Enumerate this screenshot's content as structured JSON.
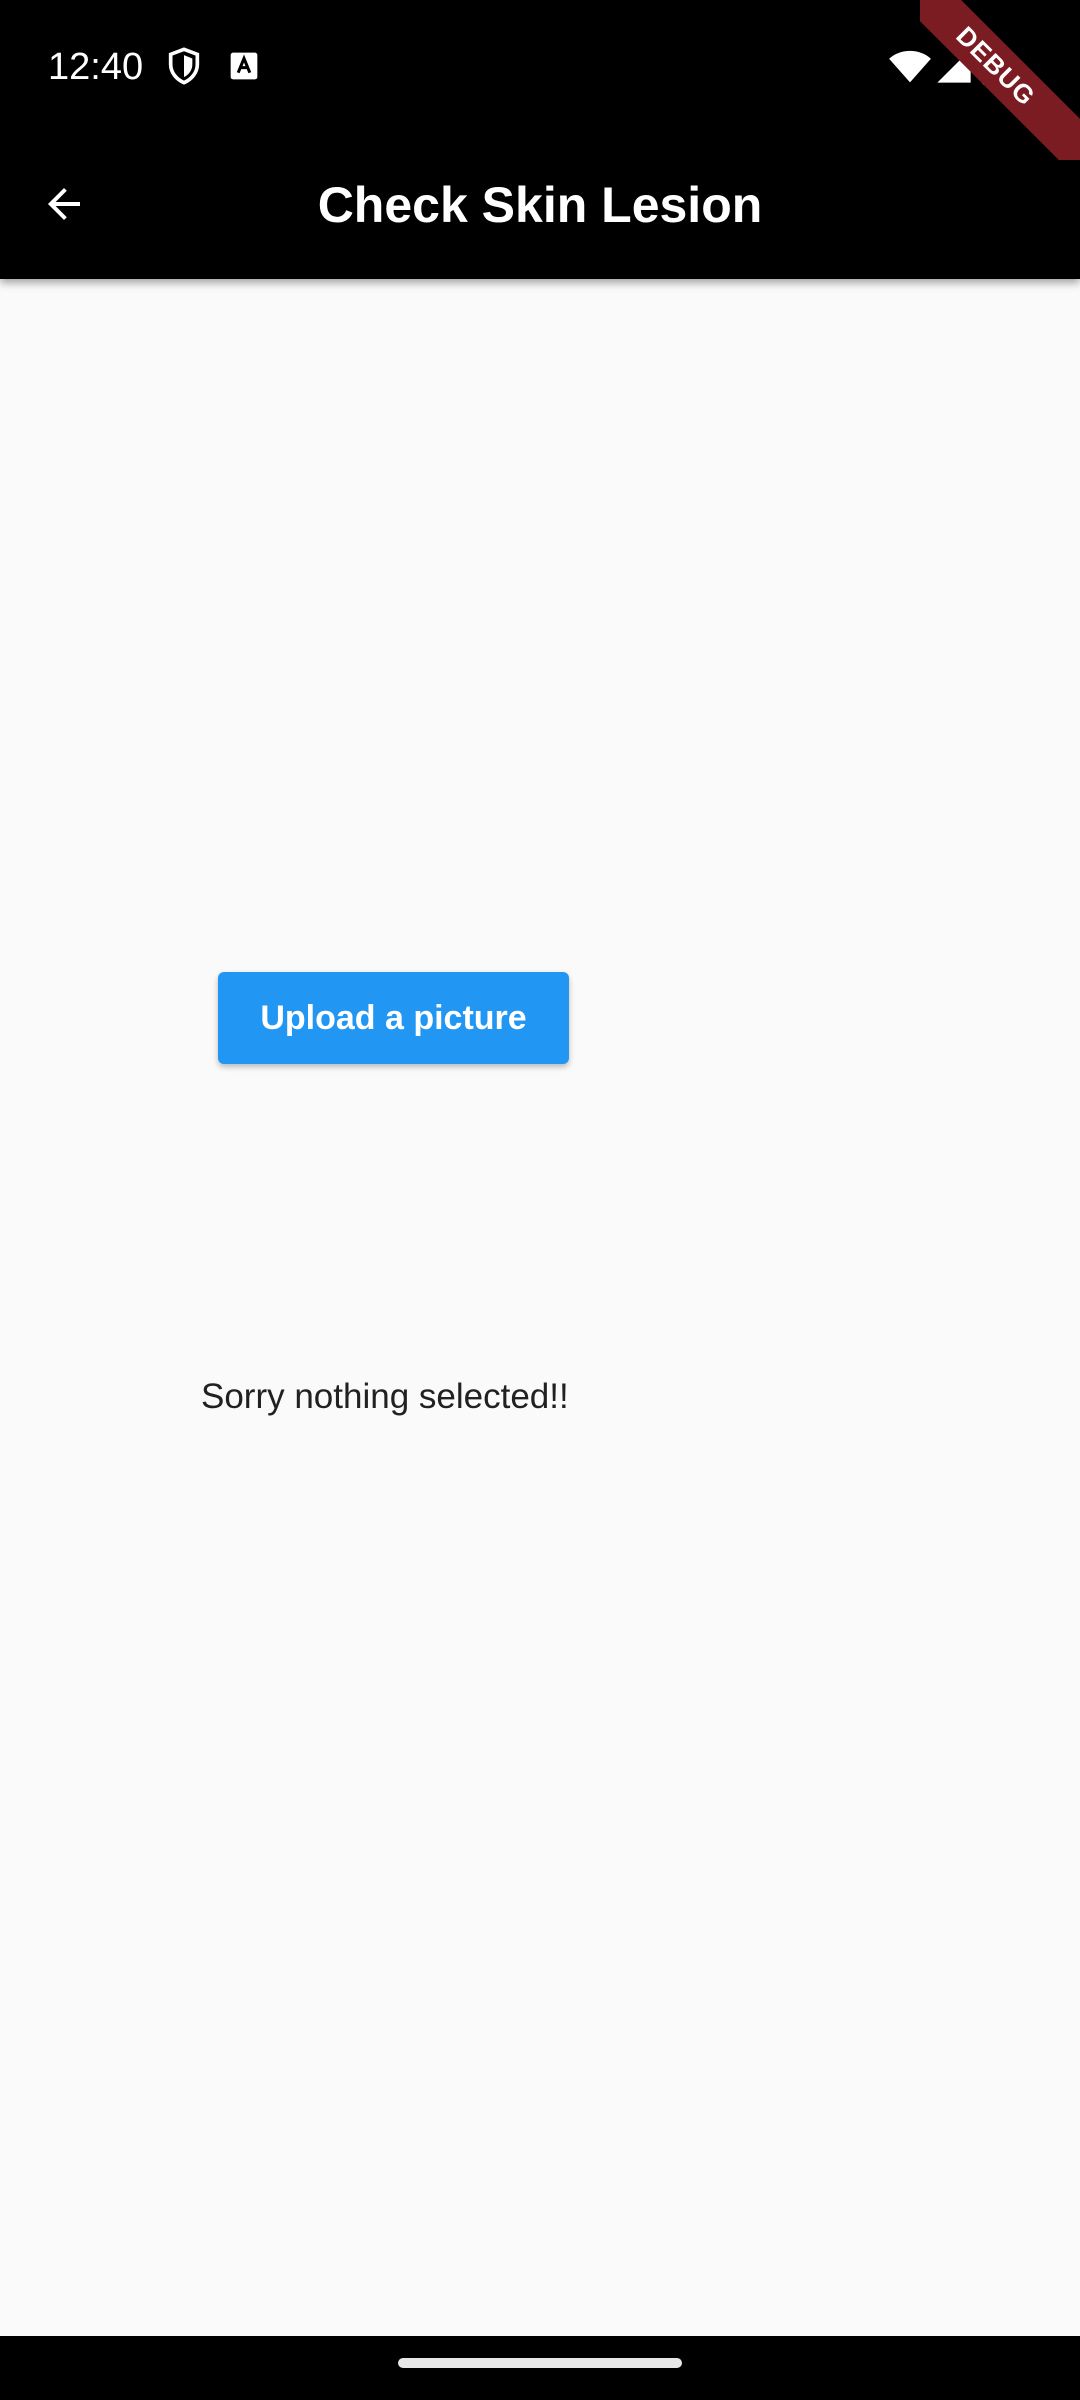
{
  "status_bar": {
    "time": "12:40"
  },
  "app_bar": {
    "title": "Check Skin Lesion"
  },
  "debug_banner": {
    "label": "DEBUG"
  },
  "main": {
    "upload_button_label": "Upload a picture",
    "status_message": "Sorry nothing selected!!"
  },
  "colors": {
    "app_bar_bg": "#000000",
    "accent": "#2196f3",
    "background": "#fafafa",
    "debug_banner": "#7b1c22"
  },
  "icons": [
    "shield-icon",
    "font-icon",
    "wifi-icon",
    "signal-icon",
    "battery-icon",
    "back-arrow-icon"
  ]
}
